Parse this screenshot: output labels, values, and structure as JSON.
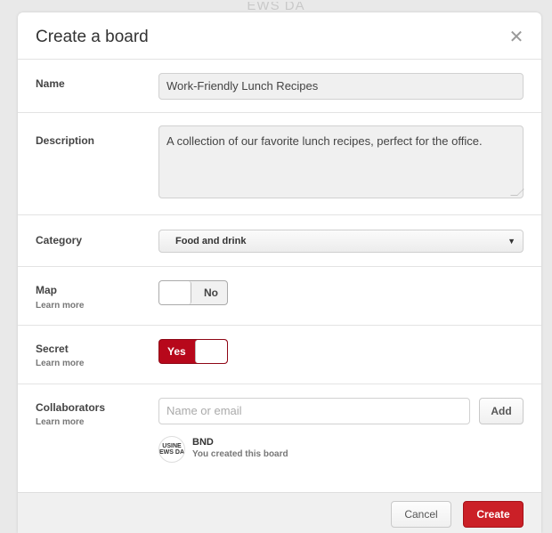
{
  "background": {
    "text": "EWS DA"
  },
  "dialog": {
    "title": "Create a board",
    "close_glyph": "✕"
  },
  "name": {
    "label": "Name",
    "value": "Work-Friendly Lunch Recipes"
  },
  "description": {
    "label": "Description",
    "value": "A collection of our favorite lunch recipes, perfect for the office."
  },
  "category": {
    "label": "Category",
    "selected": "Food and drink",
    "arrow_glyph": "▼"
  },
  "map": {
    "label": "Map",
    "learn_more": "Learn more",
    "toggle_label": "No",
    "enabled": false
  },
  "secret": {
    "label": "Secret",
    "learn_more": "Learn more",
    "toggle_label": "Yes",
    "enabled": true
  },
  "collaborators": {
    "label": "Collaborators",
    "learn_more": "Learn more",
    "placeholder": "Name or email",
    "add_label": "Add",
    "owner": {
      "avatar_text_1": "USINE",
      "avatar_text_2": "EWS DA",
      "name": "BND",
      "note": "You created this board"
    }
  },
  "footer": {
    "cancel_label": "Cancel",
    "create_label": "Create"
  },
  "colors": {
    "accent": "#cb2027",
    "toggle_on": "#b7081b"
  }
}
